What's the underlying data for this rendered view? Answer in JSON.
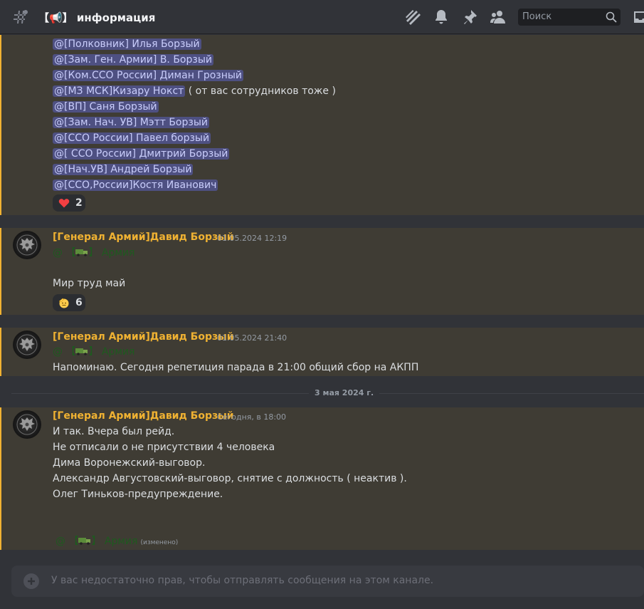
{
  "header": {
    "channel_title": "【📢】 информация",
    "search_placeholder": "Поиск",
    "icons": [
      "threads-icon",
      "bell-icon",
      "pin-icon",
      "members-icon",
      "search-icon",
      "inbox-icon"
    ]
  },
  "mention_list": [
    {
      "mention": "@[Полковник] Илья Борзый",
      "suffix": ""
    },
    {
      "mention": "@[Зам. Ген. Армии] В. Борзый",
      "suffix": ""
    },
    {
      "mention": "@[Ком.ССО России] Диман Грозный",
      "suffix": ""
    },
    {
      "mention": "@[МЗ МСК]Кизару Нокст",
      "suffix": " ( от вас сотрудников тоже )"
    },
    {
      "mention": "@[ВП] Саня Борзый",
      "suffix": ""
    },
    {
      "mention": "@[Зам. Нач. УВ] Мэтт Борзый",
      "suffix": ""
    },
    {
      "mention": "@[ССО России] Павел борзый",
      "suffix": ""
    },
    {
      "mention": " @[ ССО России] Дмитрий Борзый",
      "suffix": ""
    },
    {
      "mention": "@[Нач.УВ] Андрей Борзый",
      "suffix": ""
    },
    {
      "mention": "@[ССО,России]Костя Иванович",
      "suffix": ""
    }
  ],
  "reaction_heart": {
    "emoji": "heart",
    "count": "2"
  },
  "messages": [
    {
      "author": "[Генерал Армий]Давид Борзый",
      "timestamp": "01.05.2024 12:19",
      "role_mention": "Армия",
      "text": "Мир труд май",
      "reaction": {
        "emoji": "salute-face",
        "count": "6"
      }
    },
    {
      "author": "[Генерал Армий]Давид Борзый",
      "timestamp": "01.05.2024 21:40",
      "role_mention": "Армия",
      "text": "Напоминаю. Сегодня репетиция парада в 21:00 общий сбор на АКПП"
    },
    {
      "author": "[Генерал Армий]Давид Борзый",
      "timestamp": "Сегодня, в 18:00",
      "lines": [
        "И так. Вчера был рейд.",
        " Не отписали о не присутствии 4 человека",
        "Дима Воронежский-выговор.",
        "Александр Августовский-выговор, снятие с должность ( неактив ).",
        "Олег Тиньков-предупреждение."
      ],
      "role_mention": "Армия",
      "edited": "(изменено)"
    }
  ],
  "date_divider": "3 мая 2024 г.",
  "composer": {
    "placeholder": "У вас недостаточно прав, чтобы отправлять сообщения на этом канале."
  },
  "colors": {
    "background": "#313338",
    "highlight": "#3f3c34",
    "highlight_bar": "#f0b232",
    "mention_bg": "#4e5082",
    "role_color": "#1e5a1f"
  }
}
